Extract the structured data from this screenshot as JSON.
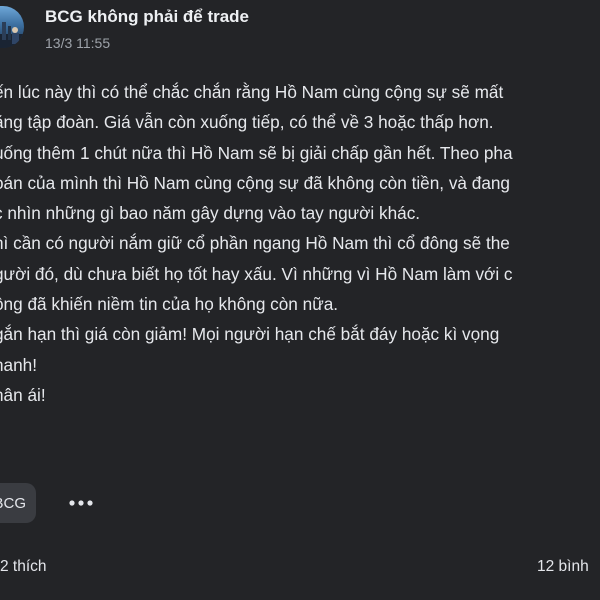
{
  "post": {
    "author": "BCG không phải để trade",
    "timestamp": "13/3 11:55",
    "lines": [
      "ến lúc này thì có thể chắc chắn rằng Hồ Nam cùng cộng sự sẽ mất",
      "ằng tập đoàn. Giá vẫn còn xuống tiếp, có thể về 3 hoặc thấp hơn.",
      "uống thêm 1 chút nữa thì Hồ Nam sẽ bị giải chấp gần hết. Theo pha",
      "oán của mình thì Hồ Nam cùng cộng sự đã không còn tiền, và đang",
      "c nhìn những gì bao năm gây dựng vào tay người khác.",
      "hì cần có người nắm giữ cổ phần ngang Hồ Nam thì cổ đông sẽ the",
      "gười đó, dù chưa biết họ tốt hay xấu. Vì những vì Hồ Nam làm với c",
      "ông đã khiến niềm tin của họ không còn nữa.",
      "gắn hạn thì giá còn giảm! Mọi người hạn chế bắt đáy hoặc kì vọng",
      "hanh!",
      "hân ái!"
    ],
    "tag": "BCG",
    "more_icon": "ellipsis-icon"
  },
  "footer": {
    "likes": "2 thích",
    "comments": "12 bình"
  },
  "colors": {
    "background": "#232427",
    "text": "#e6e8ec",
    "muted": "#9ea3aa",
    "chip": "#3a3c41"
  }
}
